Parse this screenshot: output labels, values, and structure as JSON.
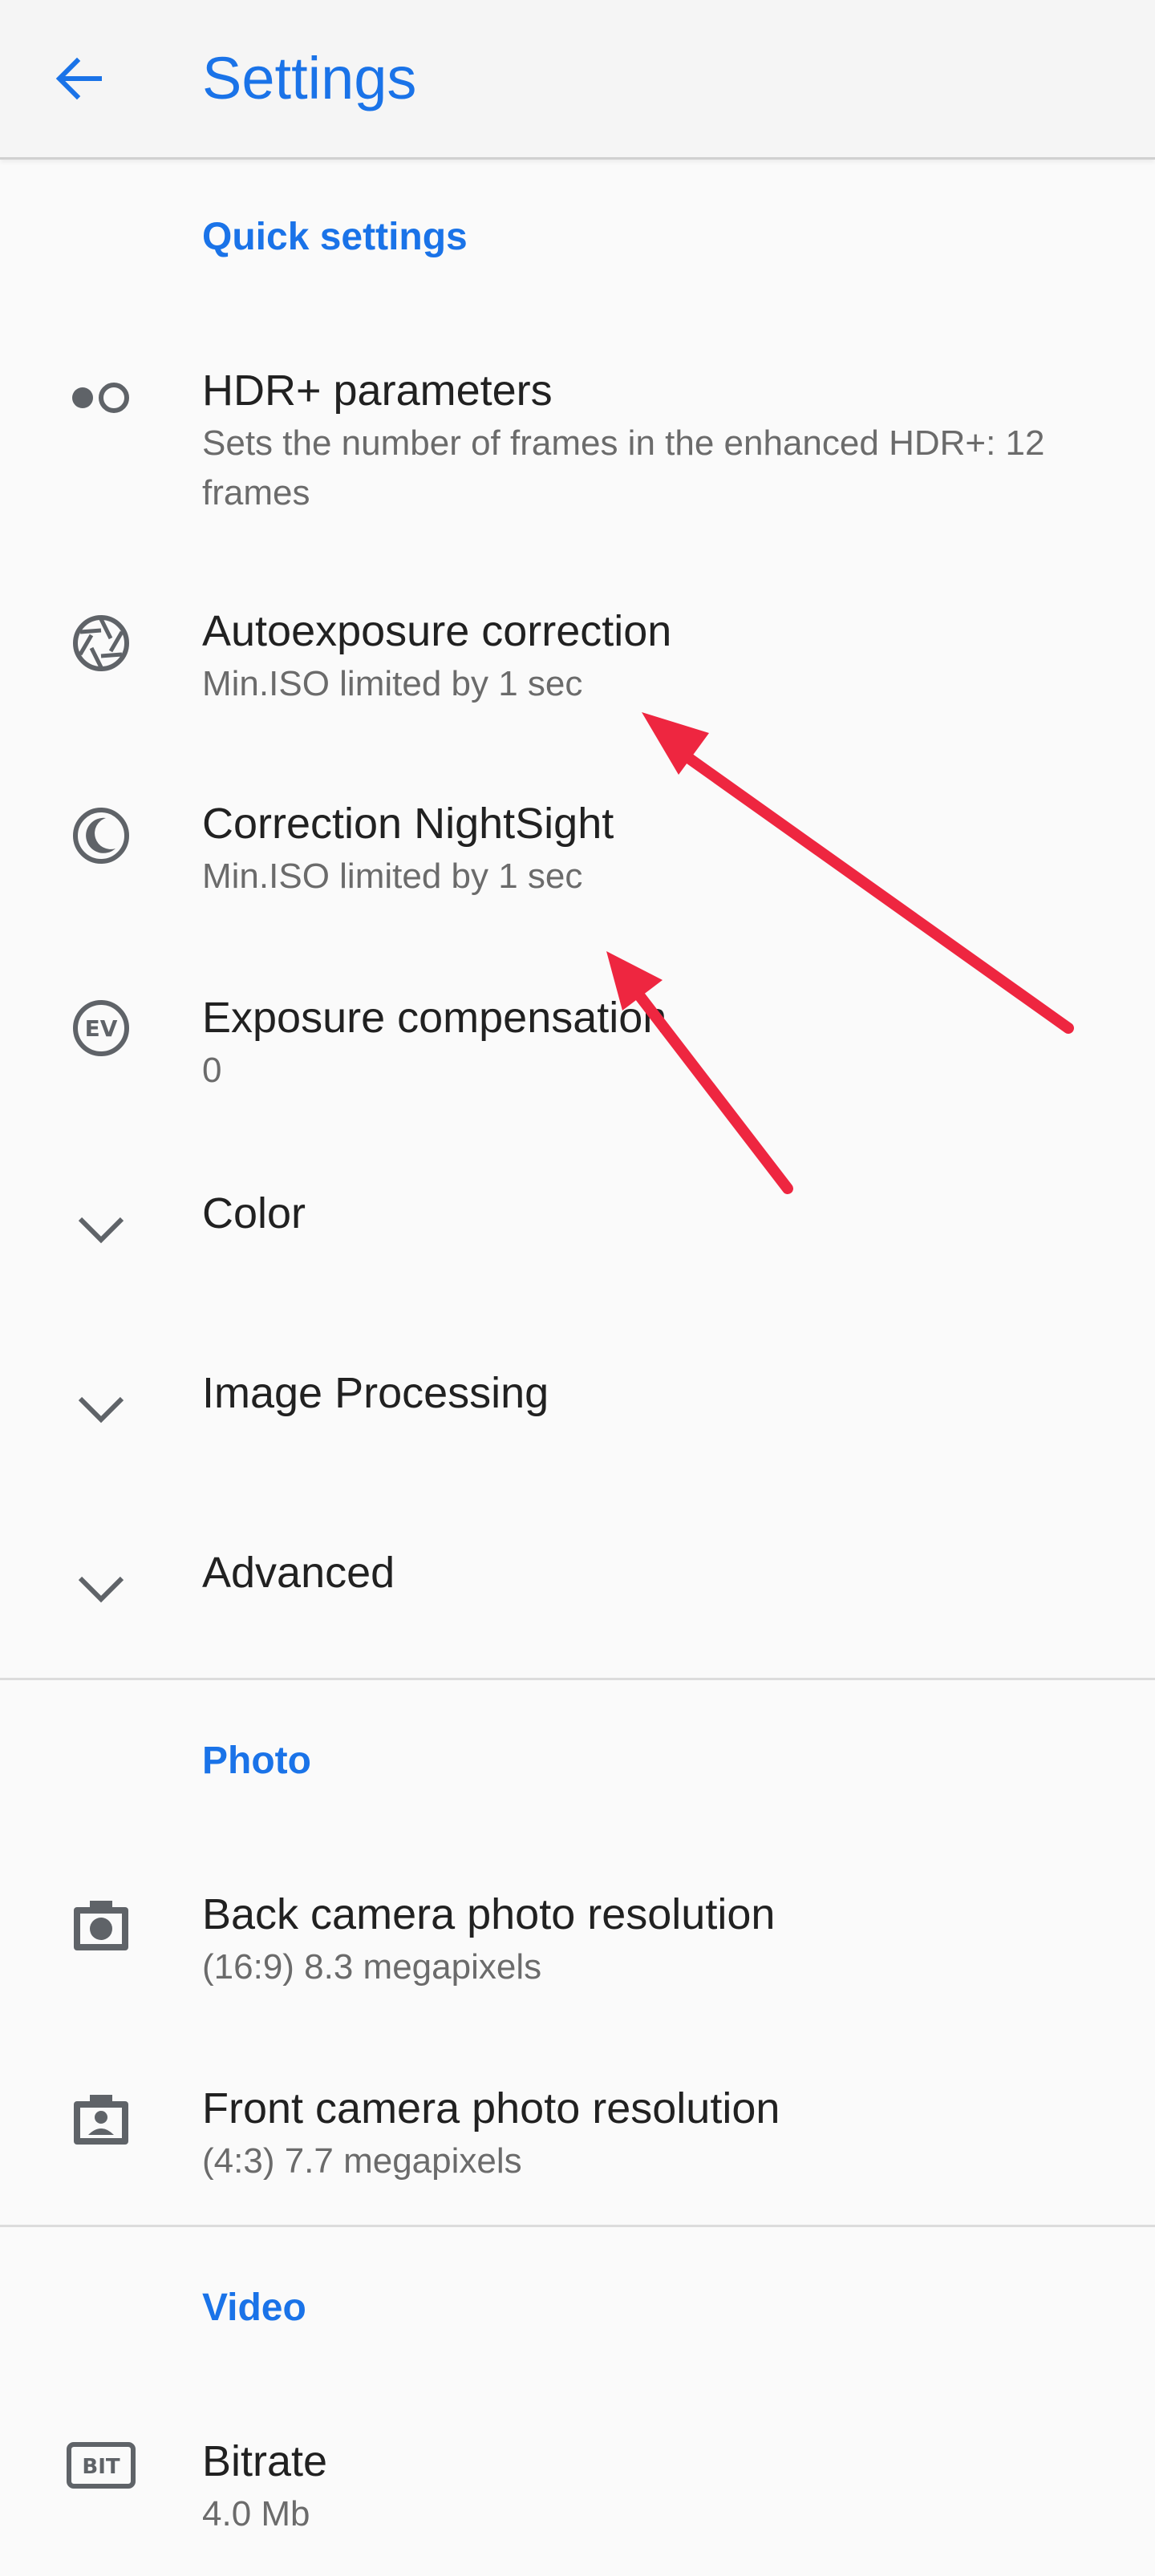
{
  "appbar": {
    "title": "Settings"
  },
  "sections": {
    "quick": "Quick settings",
    "photo": "Photo",
    "video": "Video"
  },
  "items": {
    "hdr": {
      "title": "HDR+ parameters",
      "summary": "Sets the number of frames in the enhanced HDR+: 12 frames"
    },
    "autoexposure": {
      "title": "Autoexposure correction",
      "summary": "Min.ISO limited by 1 sec"
    },
    "nightsight": {
      "title": "Correction NightSight",
      "summary": "Min.ISO limited by 1 sec"
    },
    "exposure": {
      "title": "Exposure compensation",
      "summary": "0"
    },
    "color": {
      "title": "Color"
    },
    "processing": {
      "title": "Image Processing"
    },
    "advanced": {
      "title": "Advanced"
    },
    "back_res": {
      "title": "Back camera photo resolution",
      "summary": "(16:9) 8.3 megapixels"
    },
    "front_res": {
      "title": "Front camera photo resolution",
      "summary": "(4:3) 7.7 megapixels"
    },
    "bitrate": {
      "title": "Bitrate",
      "summary": "4.0 Mb",
      "icon_text": "BIT"
    }
  },
  "icons": {
    "ev_text": "EV"
  },
  "colors": {
    "accent": "#1a73e8",
    "annotation": "#ee2640",
    "icon": "#5f6368"
  }
}
